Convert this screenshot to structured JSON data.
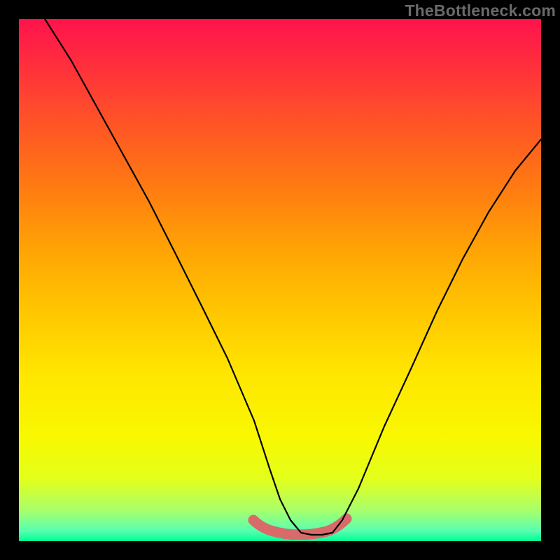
{
  "watermark": "TheBottleneck.com",
  "chart_data": {
    "type": "line",
    "title": "",
    "xlabel": "",
    "ylabel": "",
    "xlim": [
      0,
      100
    ],
    "ylim": [
      0,
      100
    ],
    "series": [
      {
        "name": "curve",
        "x": [
          5,
          10,
          15,
          20,
          25,
          30,
          35,
          40,
          45,
          48,
          50,
          52,
          54,
          56,
          58,
          60,
          62,
          65,
          70,
          75,
          80,
          85,
          90,
          95,
          100
        ],
        "values": [
          100,
          92,
          83,
          74,
          65,
          55,
          45,
          35,
          23,
          14,
          8,
          4,
          1.6,
          1.2,
          1.2,
          1.6,
          4,
          10,
          22,
          33,
          44,
          54,
          63,
          71,
          77
        ]
      },
      {
        "name": "bottom-band",
        "x": [
          47,
          49,
          51,
          53,
          55,
          57,
          59,
          61,
          63,
          65
        ],
        "values": [
          4.0,
          2.5,
          1.7,
          1.3,
          1.2,
          1.2,
          1.4,
          2.0,
          3.0,
          4.5
        ]
      }
    ],
    "annotations": [],
    "colors": {
      "curve": "#000000",
      "band": "#d96a6a",
      "gradient_top": "#ff134c",
      "gradient_bottom": "#00ff95",
      "frame": "#000000"
    }
  }
}
